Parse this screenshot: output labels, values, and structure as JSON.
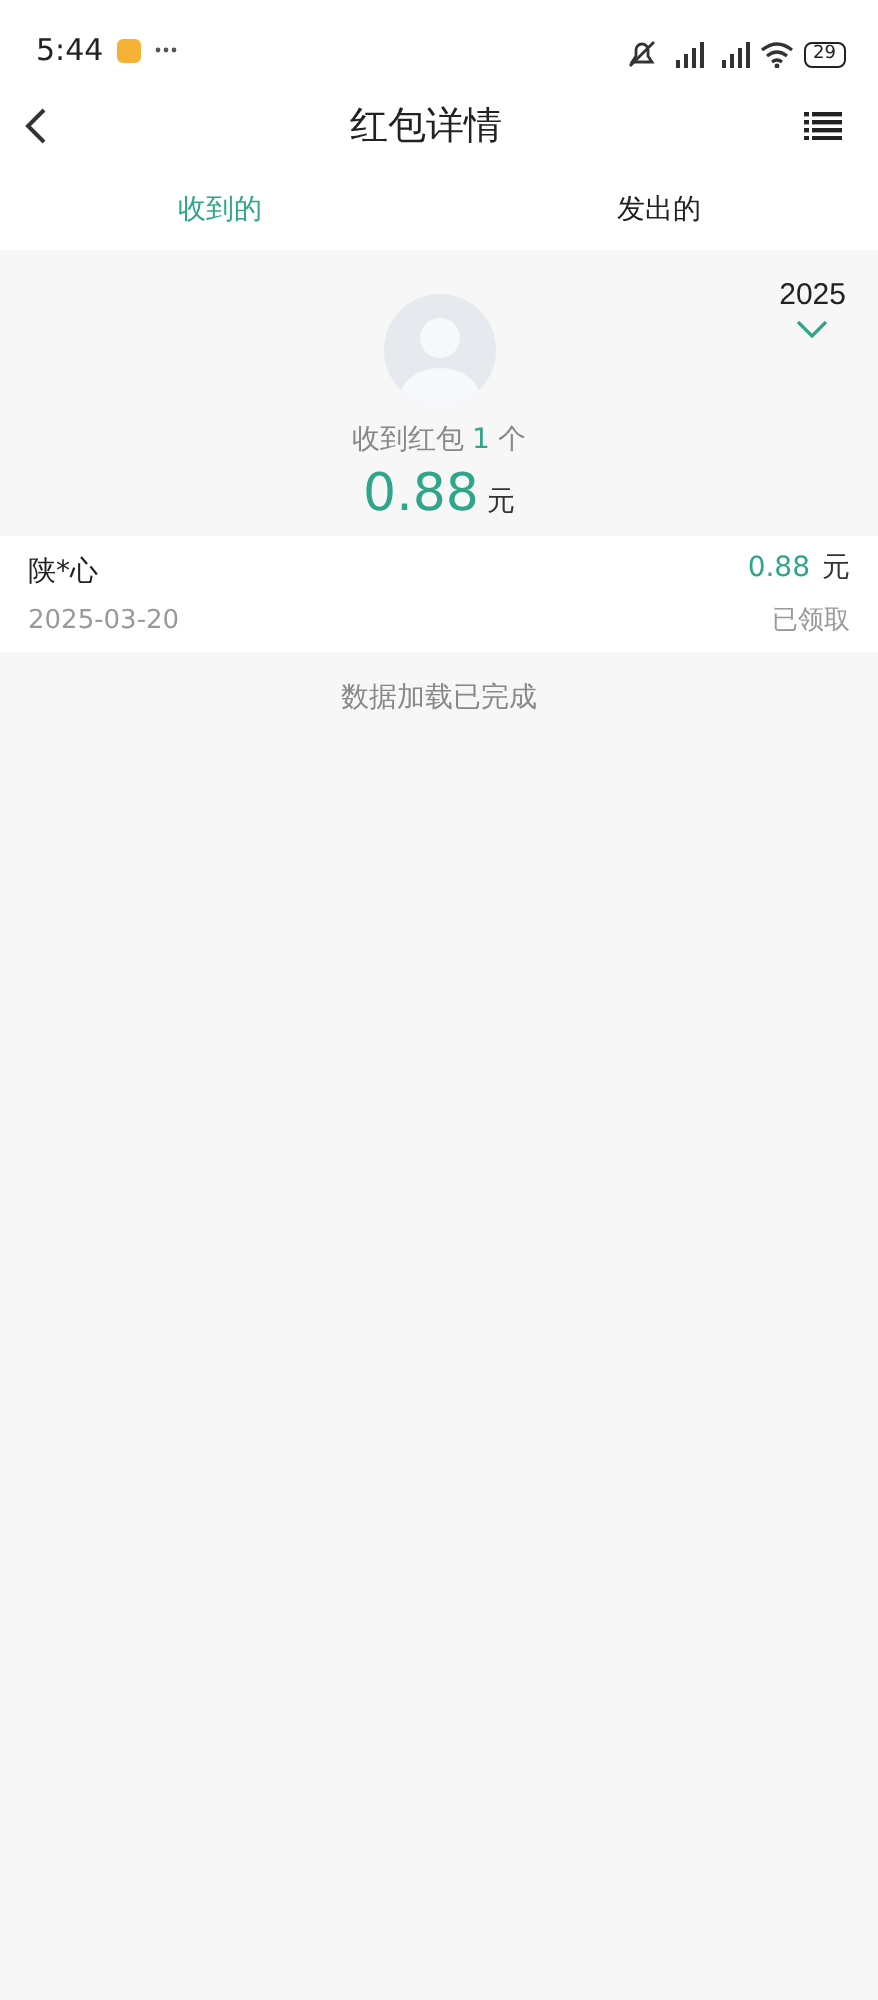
{
  "status_bar": {
    "time": "5:44",
    "battery": "29"
  },
  "header": {
    "title": "红包详情"
  },
  "tabs": [
    {
      "label": "收到的",
      "selected": true
    },
    {
      "label": "发出的",
      "selected": false
    }
  ],
  "year": "2025",
  "summary": {
    "prefix": "收到红包",
    "count": "1",
    "suffix": "个",
    "amount": "0.88",
    "unit": "元"
  },
  "records": [
    {
      "name": "陕*心",
      "date": "2025-03-20",
      "amount": "0.88",
      "unit": "元",
      "status": "已领取"
    }
  ],
  "footer": "数据加载已完成"
}
